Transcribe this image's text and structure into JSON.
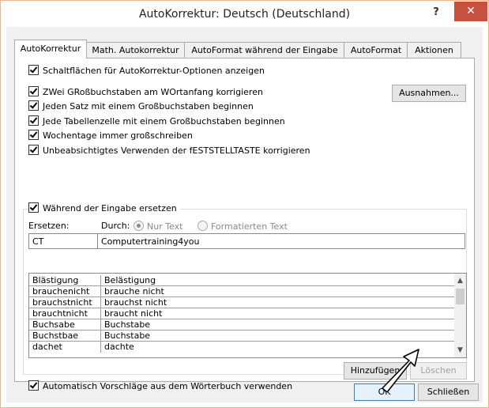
{
  "window": {
    "title": "AutoKorrektur: Deutsch (Deutschland)",
    "help_label": "?",
    "close_label": "✕"
  },
  "tabs": [
    {
      "label": "AutoKorrektur"
    },
    {
      "label": "Math. Autokorrektur"
    },
    {
      "label": "AutoFormat während der Eingabe"
    },
    {
      "label": "AutoFormat"
    },
    {
      "label": "Aktionen"
    }
  ],
  "options": {
    "show_buttons": "Schaltflächen für AutoKorrektur-Optionen anzeigen",
    "two_caps": "ZWei GRoßbuchstaben am WOrtanfang korrigieren",
    "sentence_cap": "Jeden Satz mit einem Großbuchstaben beginnen",
    "table_cell_cap": "Jede Tabellenzelle mit einem Großbuchstaben beginnen",
    "weekdays": "Wochentage immer großschreiben",
    "capslock": "Unbeabsichtigtes Verwenden der fESTSTELLTASTE korrigieren",
    "replace_while_typing": "Während der Eingabe ersetzen",
    "dictionary_suggestions": "Automatisch Vorschläge aus dem Wörterbuch verwenden"
  },
  "buttons": {
    "exceptions": "Ausnahmen...",
    "add": "Hinzufügen",
    "delete": "Löschen",
    "ok": "OK",
    "close": "Schließen"
  },
  "replace": {
    "replace_label": "Ersetzen:",
    "with_label": "Durch:",
    "plain_text": "Nur Text",
    "formatted_text": "Formatierten Text",
    "replace_value": "CT",
    "with_value": "Computertraining4you"
  },
  "entries": [
    {
      "from": "Blästigung",
      "to": "Belästigung"
    },
    {
      "from": "brauchenicht",
      "to": "brauche nicht"
    },
    {
      "from": "brauchstnicht",
      "to": "brauchst nicht"
    },
    {
      "from": "brauchtnicht",
      "to": "braucht nicht"
    },
    {
      "from": "Buchsabe",
      "to": "Buchstabe"
    },
    {
      "from": "Buchstbae",
      "to": "Buchstabe"
    },
    {
      "from": "dachet",
      "to": "dachte"
    }
  ]
}
